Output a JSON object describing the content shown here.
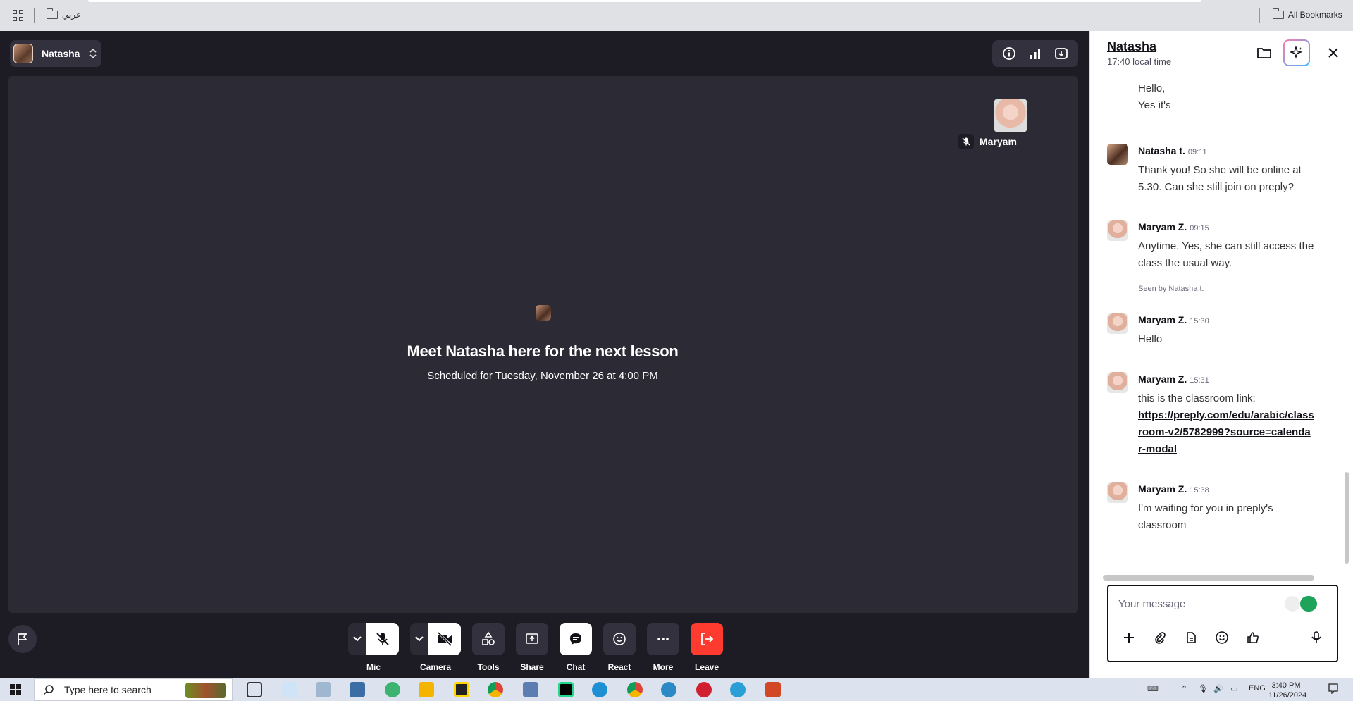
{
  "bookmarks": {
    "folder_label": "عربي",
    "all_bookmarks_label": "All Bookmarks"
  },
  "video": {
    "participant_name": "Natasha",
    "tile_name": "Maryam",
    "meet_title": "Meet Natasha here for the next lesson",
    "meet_subtitle": "Scheduled for Tuesday, November 26 at 4:00 PM"
  },
  "controls": [
    {
      "label": "Mic",
      "icon": "mic-off-icon"
    },
    {
      "label": "Camera",
      "icon": "camera-off-icon"
    },
    {
      "label": "Tools",
      "icon": "tools-icon"
    },
    {
      "label": "Share",
      "icon": "share-screen-icon"
    },
    {
      "label": "Chat",
      "icon": "chat-icon"
    },
    {
      "label": "React",
      "icon": "smiley-icon"
    },
    {
      "label": "More",
      "icon": "more-icon"
    },
    {
      "label": "Leave",
      "icon": "leave-icon"
    }
  ],
  "chat": {
    "name": "Natasha",
    "local_time": "17:40 local time",
    "messages": [
      {
        "author": "",
        "time": "",
        "text_lines": [
          "Hello,",
          "Yes it's"
        ]
      },
      {
        "author": "Natasha t.",
        "time": "09:11",
        "text": "Thank you! So she will be online at 5.30. Can she still join on preply?"
      },
      {
        "author": "Maryam Z.",
        "time": "09:15",
        "text": "Anytime. Yes, she can still access the class the usual way.",
        "note": "Seen by Natasha t."
      },
      {
        "author": "Maryam Z.",
        "time": "15:30",
        "text": "Hello"
      },
      {
        "author": "Maryam Z.",
        "time": "15:31",
        "text": "this is the classroom link:",
        "link": "https://preply.com/edu/arabic/classroom-v2/5782999?source=calendar-modal"
      },
      {
        "author": "Maryam Z.",
        "time": "15:38",
        "text": "I'm waiting for you in preply's classroom",
        "note": "Sent"
      }
    ],
    "composer_placeholder": "Your message"
  },
  "taskbar": {
    "search_placeholder": "Type here to search",
    "lang": "ENG",
    "time": "3:40 PM",
    "date": "11/26/2024"
  },
  "colors": {
    "app_bg": "#1d1c25",
    "stage_bg": "#2b2a35",
    "leave_red": "#ff3b30",
    "ai_gradient_start": "#ff7aac",
    "ai_gradient_end": "#3db7ff"
  }
}
